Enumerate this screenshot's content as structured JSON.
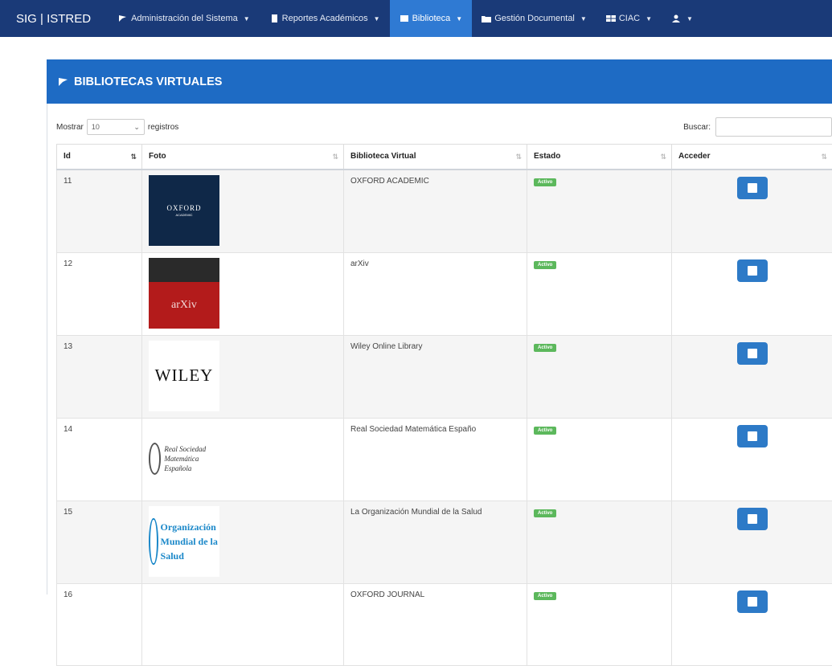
{
  "brand": "SIG | ISTRED",
  "nav": [
    {
      "label": "Administración del Sistema",
      "icon": "flag-icon",
      "active": false
    },
    {
      "label": "Reportes Académicos",
      "icon": "file-icon",
      "active": false
    },
    {
      "label": "Biblioteca",
      "icon": "book-icon",
      "active": true
    },
    {
      "label": "Gestión Documental",
      "icon": "folder-icon",
      "active": false
    },
    {
      "label": "CIAC",
      "icon": "grid-icon",
      "active": false
    },
    {
      "label": "",
      "icon": "user-lock-icon",
      "active": false
    }
  ],
  "panel": {
    "title": "BIBLIOTECAS VIRTUALES",
    "icon": "flag-icon"
  },
  "controls": {
    "show_prefix": "Mostrar",
    "show_value": "10",
    "show_suffix": "registros",
    "search_label": "Buscar:",
    "search_value": ""
  },
  "table": {
    "columns": [
      "Id",
      "Foto",
      "Biblioteca Virtual",
      "Estado",
      "Acceder"
    ],
    "rows": [
      {
        "id": "11",
        "logo": "oxford",
        "logo_text": "OXFORD",
        "logo_sub": "ACADEMIC",
        "name": "OXFORD ACADEMIC",
        "estado": "Activo"
      },
      {
        "id": "12",
        "logo": "arxiv",
        "logo_text": "arXiv",
        "logo_sub": "",
        "name": "arXiv",
        "estado": "Activo"
      },
      {
        "id": "13",
        "logo": "wiley",
        "logo_text": "WILEY",
        "logo_sub": "",
        "name": "Wiley Online Library",
        "estado": "Activo"
      },
      {
        "id": "14",
        "logo": "rsme",
        "logo_text": "Real Sociedad Matemática Española",
        "logo_sub": "",
        "name": "Real Sociedad Matemática Españo",
        "estado": "Activo"
      },
      {
        "id": "15",
        "logo": "oms",
        "logo_text": "Organización Mundial de la Salud",
        "logo_sub": "",
        "name": "La Organización Mundial de la Salud",
        "estado": "Activo"
      },
      {
        "id": "16",
        "logo": "none",
        "logo_text": "",
        "logo_sub": "",
        "name": "OXFORD JOURNAL",
        "estado": "Activo"
      }
    ]
  },
  "colors": {
    "navbar": "#1a3a78",
    "nav_active": "#2f7ad3",
    "panel_header": "#1e6bc4",
    "badge": "#5cb85c",
    "button": "#2d7ac7"
  }
}
